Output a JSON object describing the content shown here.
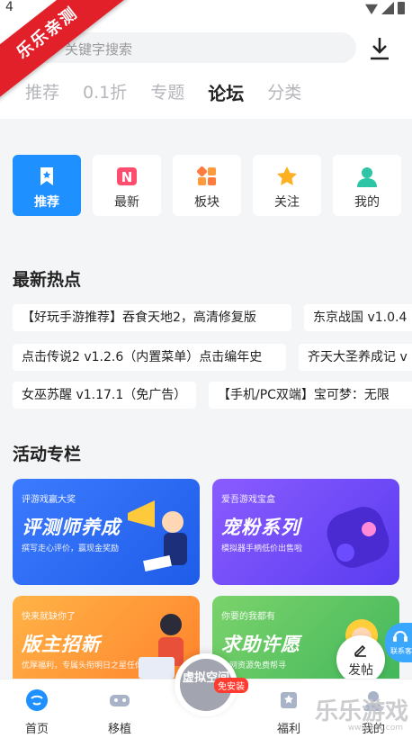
{
  "corner_banner": "乐乐亲测",
  "status": {
    "time": "4"
  },
  "search": {
    "placeholder": "关键字搜索"
  },
  "tabs": [
    "推荐",
    "0.1折",
    "专题",
    "论坛",
    "分类"
  ],
  "quick": [
    {
      "label": "推荐",
      "icon": "bookmark-icon"
    },
    {
      "label": "最新",
      "icon": "new-badge-icon"
    },
    {
      "label": "板块",
      "icon": "grid-icon"
    },
    {
      "label": "关注",
      "icon": "star-icon"
    },
    {
      "label": "我的",
      "icon": "user-icon"
    }
  ],
  "hot": {
    "title": "最新热点",
    "tags": [
      "【好玩手游推荐】吞食天地2，高清修复版",
      "东京战国 v1.0.4",
      "点击传说2 v1.2.6（内置菜单）点击编年史",
      "齐天大圣养成记 v",
      "女巫苏醒 v1.17.1（免广告）",
      "【手机/PC双端】宝可梦：无限"
    ]
  },
  "activity": {
    "title": "活动专栏",
    "cards": [
      {
        "tag": "评游戏赢大奖",
        "title": "评测师养成",
        "sub": "撰写走心评价，赢现金奖励"
      },
      {
        "tag": "爱吾游戏宝盒",
        "title": "宠粉系列",
        "sub": "模拟器手柄低价出售啦"
      },
      {
        "tag": "快来就缺你了",
        "title": "版主招新",
        "sub": "优厚福利，专属头衔明日之星任你选"
      },
      {
        "tag": "你要的我都有",
        "title": "求助许愿",
        "sub": "全网资源免费帮寻"
      }
    ]
  },
  "fab": {
    "label": "发帖"
  },
  "side_help": {
    "label": "联系客服"
  },
  "bottom_nav": {
    "items": [
      "首页",
      "移植",
      "福利",
      "我的"
    ],
    "center_label": "虚拟空间",
    "center_badge": "免安装"
  },
  "watermark": {
    "text": "乐乐游戏",
    "url": "www.66t.com"
  },
  "colors": {
    "accent": "#1e90ff",
    "banner": "#e2202a",
    "background": "#f4f5f7"
  }
}
